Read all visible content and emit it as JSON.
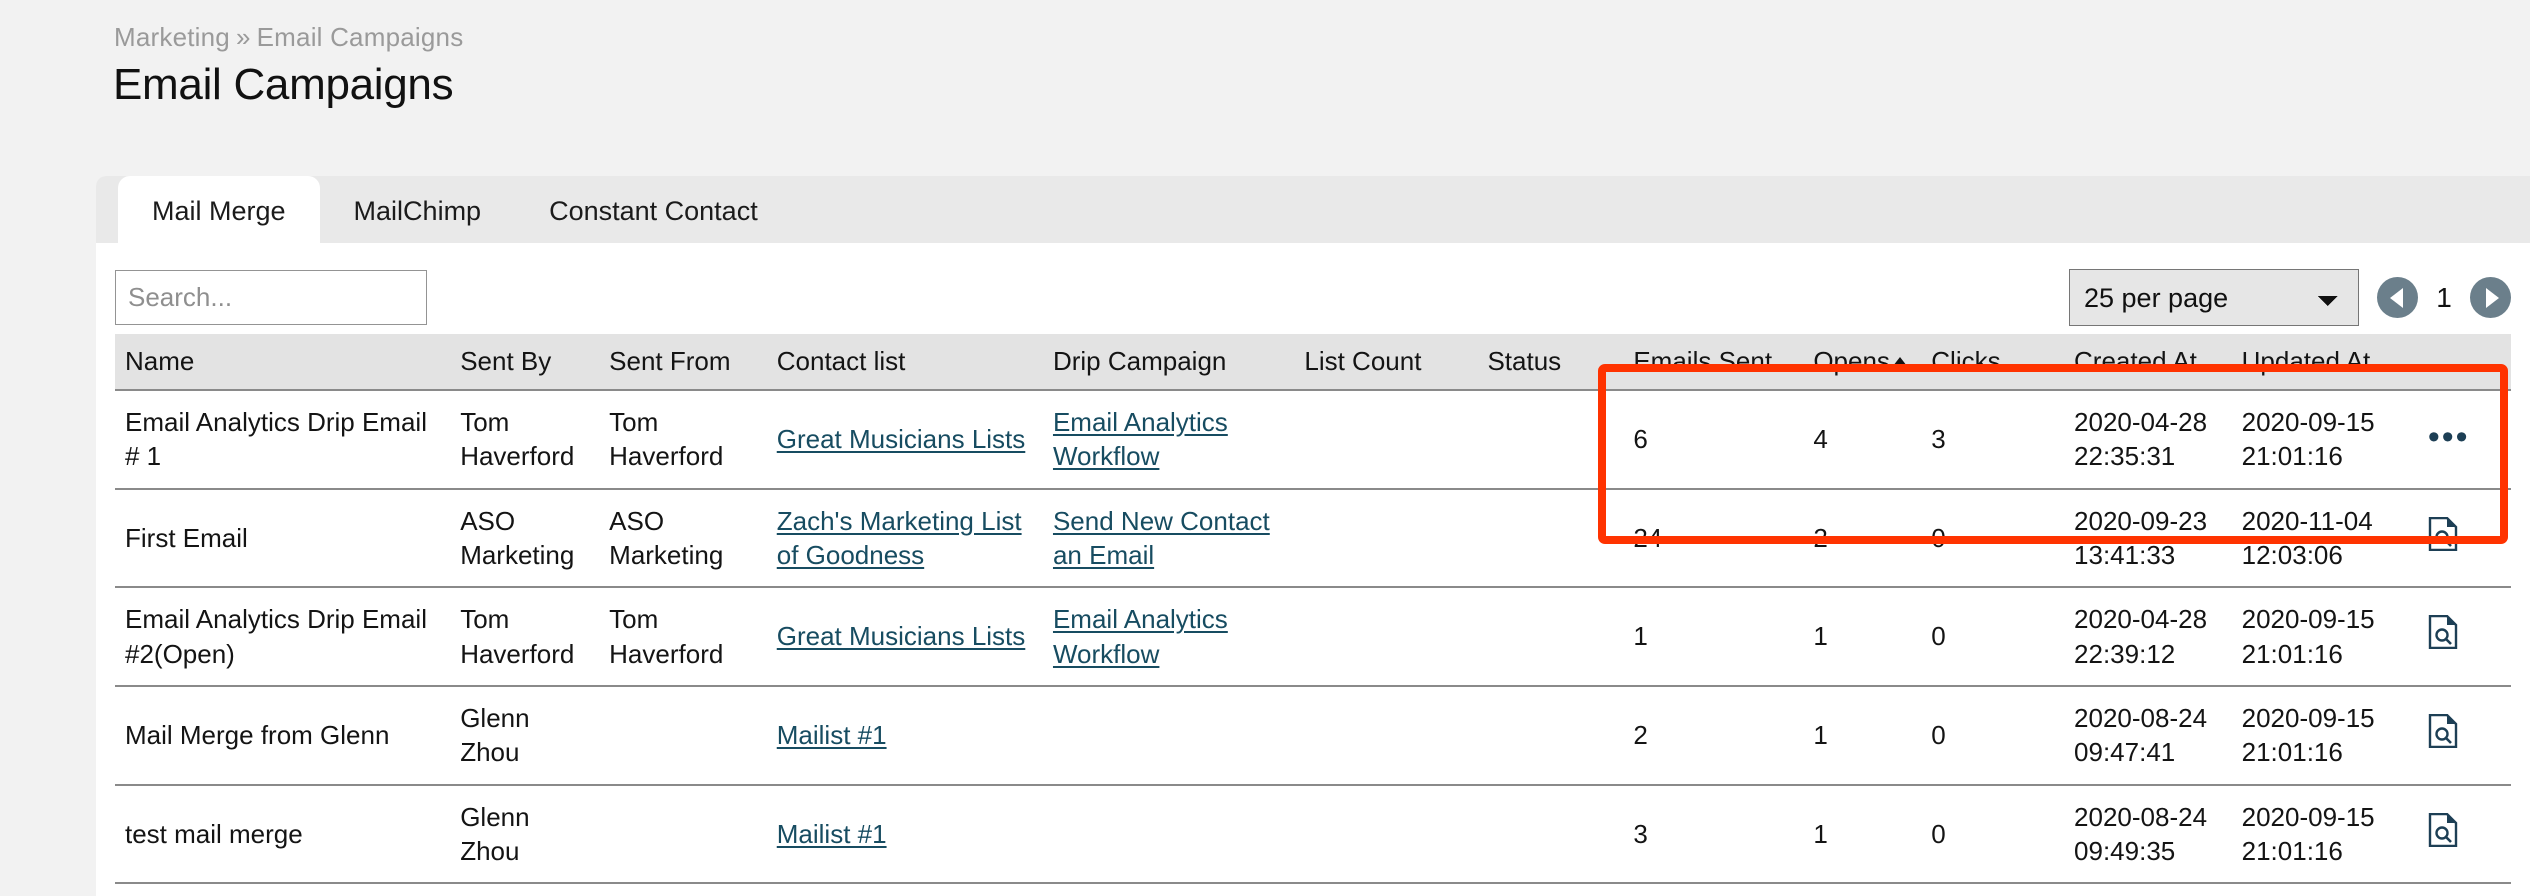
{
  "breadcrumb": {
    "parent": "Marketing",
    "separator": "»",
    "current": "Email Campaigns"
  },
  "page_title": "Email Campaigns",
  "tabs": [
    {
      "label": "Mail Merge",
      "active": true
    },
    {
      "label": "MailChimp",
      "active": false
    },
    {
      "label": "Constant Contact",
      "active": false
    }
  ],
  "toolbar": {
    "search_placeholder": "Search...",
    "search_value": "",
    "per_page_selected": "25 per page",
    "per_page_options": [
      "25 per page"
    ],
    "page_number": "1",
    "prev_icon": "chevron-left-icon",
    "next_icon": "chevron-right-icon"
  },
  "table": {
    "columns": [
      {
        "key": "name",
        "label": "Name"
      },
      {
        "key": "sent_by",
        "label": "Sent By"
      },
      {
        "key": "sent_from",
        "label": "Sent From"
      },
      {
        "key": "contact_list",
        "label": "Contact list"
      },
      {
        "key": "drip_campaign",
        "label": "Drip Campaign"
      },
      {
        "key": "list_count",
        "label": "List Count"
      },
      {
        "key": "status",
        "label": "Status"
      },
      {
        "key": "emails_sent",
        "label": "Emails Sent"
      },
      {
        "key": "opens",
        "label": "Opens",
        "sorted": "asc"
      },
      {
        "key": "clicks",
        "label": "Clicks"
      },
      {
        "key": "created_at",
        "label": "Created At"
      },
      {
        "key": "updated_at",
        "label": "Updated At"
      },
      {
        "key": "actions",
        "label": ""
      }
    ],
    "rows": [
      {
        "name": "Email Analytics Drip Email # 1",
        "sent_by": "Tom Haverford",
        "sent_from": "Tom Haverford",
        "contact_list": "Great Musicians Lists",
        "drip_campaign": "Email Analytics Workflow",
        "list_count": "",
        "status": "",
        "emails_sent": "6",
        "opens": "4",
        "clicks": "3",
        "created_at": "2020-04-28 22:35:31",
        "updated_at": "2020-09-15 21:01:16",
        "action_icon": "ellipsis-icon"
      },
      {
        "name": "First Email",
        "sent_by": "ASO Marketing",
        "sent_from": "ASO Marketing",
        "contact_list": "Zach's Marketing List of Goodness",
        "drip_campaign": "Send New Contact an Email",
        "list_count": "",
        "status": "",
        "emails_sent": "24",
        "opens": "2",
        "clicks": "0",
        "created_at": "2020-09-23 13:41:33",
        "updated_at": "2020-11-04 12:03:06",
        "action_icon": "document-search-icon"
      },
      {
        "name": "Email Analytics Drip Email #2(Open)",
        "sent_by": "Tom Haverford",
        "sent_from": "Tom Haverford",
        "contact_list": "Great Musicians Lists",
        "drip_campaign": "Email Analytics Workflow",
        "list_count": "",
        "status": "",
        "emails_sent": "1",
        "opens": "1",
        "clicks": "0",
        "created_at": "2020-04-28 22:39:12",
        "updated_at": "2020-09-15 21:01:16",
        "action_icon": "document-search-icon"
      },
      {
        "name": "Mail Merge from Glenn",
        "sent_by": "Glenn Zhou",
        "sent_from": "",
        "contact_list": "Mailist #1",
        "drip_campaign": "",
        "list_count": "",
        "status": "",
        "emails_sent": "2",
        "opens": "1",
        "clicks": "0",
        "created_at": "2020-08-24 09:47:41",
        "updated_at": "2020-09-15 21:01:16",
        "action_icon": "document-search-icon"
      },
      {
        "name": "test mail merge",
        "sent_by": "Glenn Zhou",
        "sent_from": "",
        "contact_list": "Mailist #1",
        "drip_campaign": "",
        "list_count": "",
        "status": "",
        "emails_sent": "3",
        "opens": "1",
        "clicks": "0",
        "created_at": "2020-08-24 09:49:35",
        "updated_at": "2020-09-15 21:01:16",
        "action_icon": "document-search-icon"
      }
    ]
  },
  "annotation": {
    "color": "#ff3300",
    "shape": "rectangle-outline"
  },
  "colors": {
    "page_background": "#f2f2f2",
    "card_background": "#ffffff",
    "tabstrip_background": "#e9e9e9",
    "table_header_background": "#e3e3e3",
    "link": "#174c61",
    "pager_button": "#6b7f8b",
    "annotation": "#ff3300",
    "breadcrumb_text": "#9a9a9a"
  }
}
